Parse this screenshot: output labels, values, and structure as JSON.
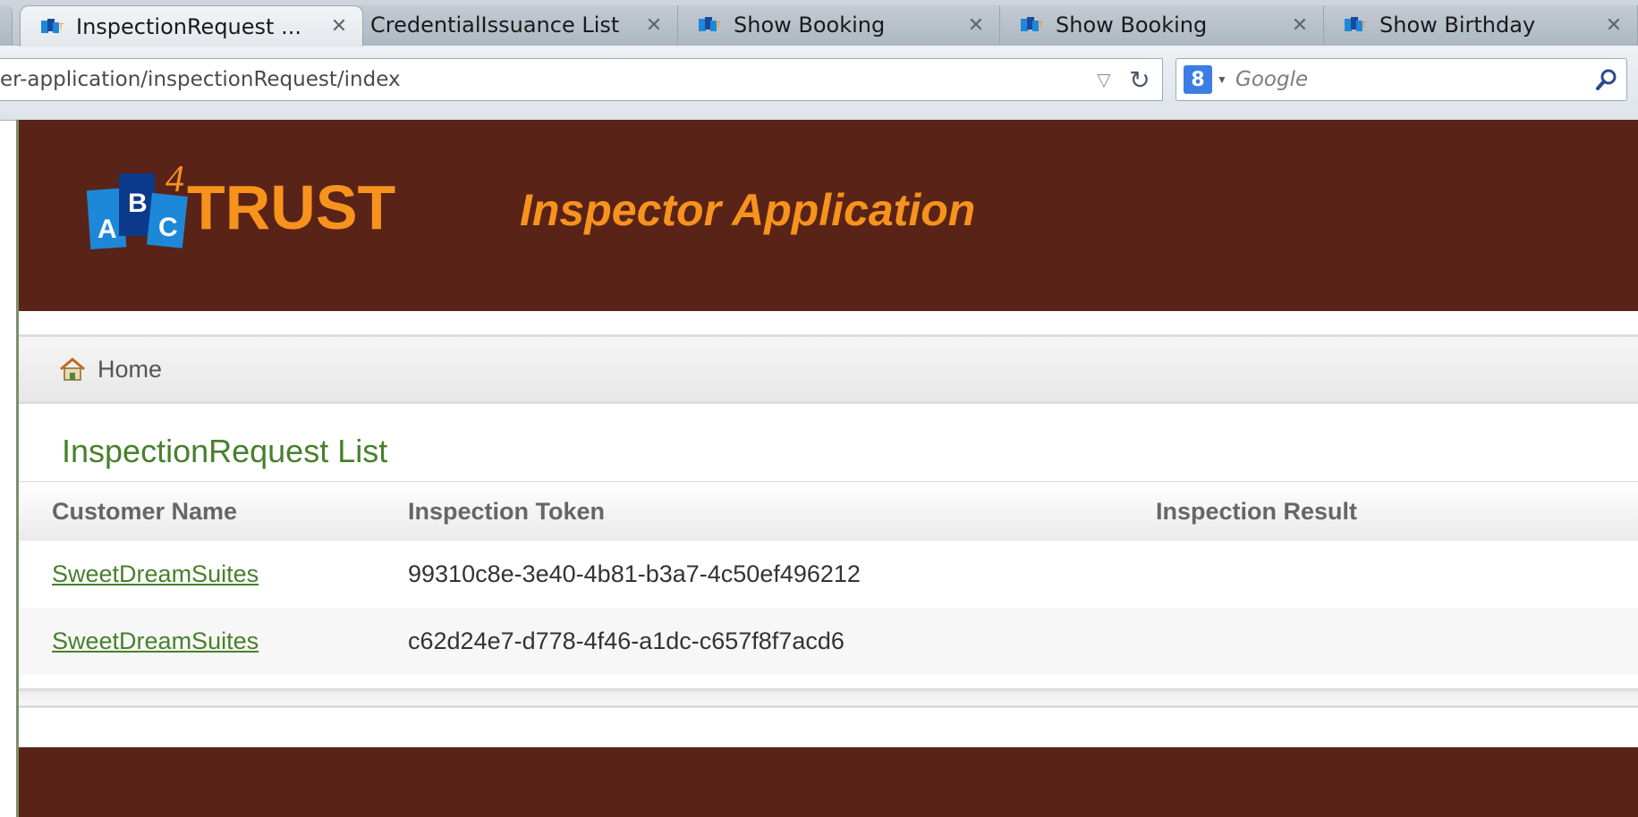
{
  "browser": {
    "tabs": [
      {
        "label": "InspectionRequest ...",
        "close": "✕",
        "active": true
      },
      {
        "label": "CredentialIssuance List",
        "close": "✕",
        "active": false
      },
      {
        "label": "Show Booking",
        "close": "✕",
        "active": false
      },
      {
        "label": "Show Booking",
        "close": "✕",
        "active": false
      },
      {
        "label": "Show Birthday",
        "close": "✕",
        "active": false
      }
    ],
    "address": "er-application/inspectionRequest/index",
    "search": {
      "engine_glyph": "8",
      "placeholder": "Google"
    }
  },
  "header": {
    "logo": {
      "letters": [
        "A",
        "B",
        "C"
      ],
      "superscript": "4",
      "word": "TRUST"
    },
    "app_title": "Inspector Application"
  },
  "nav": {
    "home_label": "Home"
  },
  "main": {
    "title": "InspectionRequest List",
    "table": {
      "columns": [
        "Customer Name",
        "Inspection Token",
        "Inspection Result"
      ],
      "rows": [
        {
          "customer": "SweetDreamSuites",
          "token": "99310c8e-3e40-4b81-b3a7-4c50ef496212",
          "result": ""
        },
        {
          "customer": "SweetDreamSuites",
          "token": "c62d24e7-d778-4f46-a1dc-c657f8f7acd6",
          "result": ""
        }
      ]
    }
  },
  "colors": {
    "header_bg": "#5a2318",
    "accent_orange": "#f7931d",
    "link_green": "#48802c",
    "logo_blue": "#1e88d8"
  }
}
